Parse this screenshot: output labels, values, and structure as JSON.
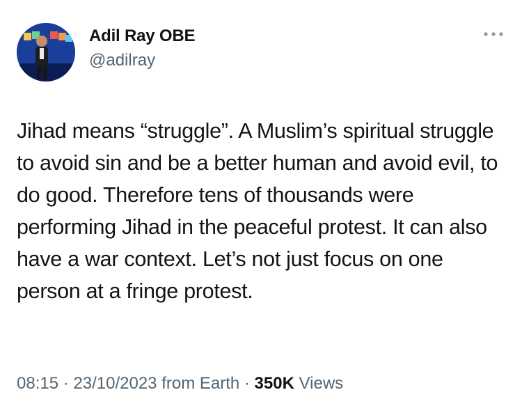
{
  "author": {
    "name": "Adil Ray OBE",
    "handle": "@adilray"
  },
  "icons": {
    "more": "more-horizontal-icon",
    "avatar": "profile-avatar"
  },
  "tweet": {
    "text": "Jihad means “struggle”. A Muslim’s spiritual struggle to avoid sin and be a better human and avoid evil, to do good. Therefore tens of thousands were performing Jihad in the peaceful protest. It can also have a war context. Let’s not just focus on one person at a fringe protest."
  },
  "meta": {
    "time": "08:15",
    "separator": " · ",
    "date": "23/10/2023",
    "source": "from Earth",
    "views_count": "350K",
    "views_label": "Views"
  },
  "colors": {
    "text": "#0f1419",
    "secondary": "#536471",
    "background": "#ffffff"
  }
}
